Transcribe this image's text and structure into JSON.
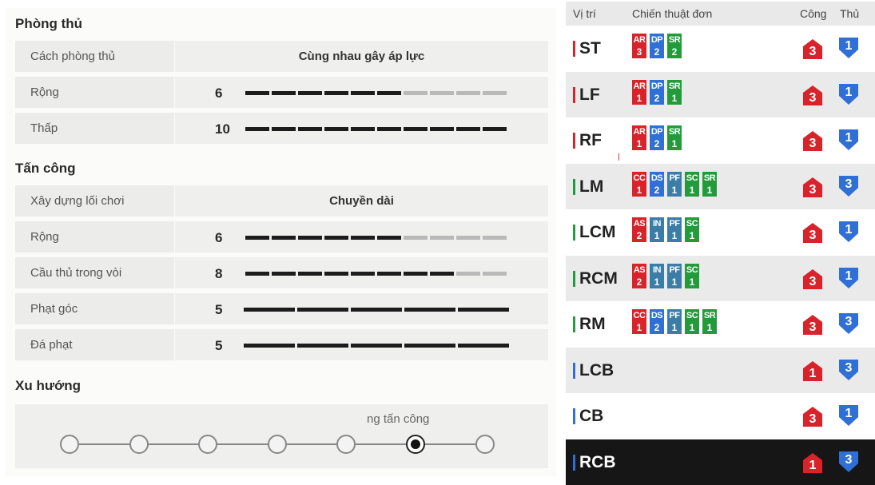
{
  "left": {
    "defense_title": "Phòng thủ",
    "defense": {
      "style": {
        "label": "Cách phòng thủ",
        "value": "Cùng nhau gây áp lực"
      },
      "width": {
        "label": "Rộng",
        "value": "6",
        "level": 6
      },
      "depth": {
        "label": "Thấp",
        "value": "10",
        "level": 10
      }
    },
    "attack_title": "Tấn công",
    "attack": {
      "buildup": {
        "label": "Xây dựng lối chơi",
        "value": "Chuyền dài"
      },
      "width": {
        "label": "Rộng",
        "value": "6",
        "level": 6
      },
      "players_in_box": {
        "label": "Cầu thủ trong vòi",
        "value": "8",
        "level": 8
      },
      "corners": {
        "label": "Phạt góc",
        "value": "5",
        "level": 5
      },
      "free_kicks": {
        "label": "Đá phạt",
        "value": "5",
        "level": 5
      }
    },
    "tendency_title": "Xu hướng",
    "tendency": {
      "label": "ng tấn công",
      "selected_index": 5,
      "nodes": 7
    }
  },
  "right": {
    "headers": {
      "position": "Vị trí",
      "tactics": "Chiến thuật đơn",
      "attack": "Công",
      "defense": "Thủ"
    },
    "colors": {
      "red": "#d8232a",
      "blue": "#2f6fd6",
      "teal": "#3c7da8",
      "green": "#239b3b",
      "attack_badge": "#d8232a",
      "defense_badge": "#2f6fd6"
    },
    "rows": [
      {
        "pos": "ST",
        "bar": "#d8232a",
        "bg": "w",
        "chips": [
          {
            "ab": "AR",
            "lv": "3",
            "c": "red"
          },
          {
            "ab": "DP",
            "lv": "2",
            "c": "blue"
          },
          {
            "ab": "SR",
            "lv": "2",
            "c": "green"
          }
        ],
        "atk": "3",
        "def": "1"
      },
      {
        "pos": "LF",
        "bar": "#d8232a",
        "bg": "g",
        "chips": [
          {
            "ab": "AR",
            "lv": "1",
            "c": "red"
          },
          {
            "ab": "DP",
            "lv": "2",
            "c": "blue"
          },
          {
            "ab": "SR",
            "lv": "1",
            "c": "green"
          }
        ],
        "atk": "3",
        "def": "1"
      },
      {
        "pos": "RF",
        "bar": "#d8232a",
        "bg": "w",
        "chips": [
          {
            "ab": "AR",
            "lv": "1",
            "c": "red"
          },
          {
            "ab": "DP",
            "lv": "2",
            "c": "blue"
          },
          {
            "ab": "SR",
            "lv": "1",
            "c": "green"
          }
        ],
        "atk": "3",
        "def": "1"
      },
      {
        "pos": "LM",
        "bar": "#239b3b",
        "bg": "g",
        "chips": [
          {
            "ab": "CC",
            "lv": "1",
            "c": "red"
          },
          {
            "ab": "DS",
            "lv": "2",
            "c": "blue"
          },
          {
            "ab": "PF",
            "lv": "1",
            "c": "teal"
          },
          {
            "ab": "SC",
            "lv": "1",
            "c": "green"
          },
          {
            "ab": "SR",
            "lv": "1",
            "c": "green"
          }
        ],
        "atk": "3",
        "def": "3"
      },
      {
        "pos": "LCM",
        "bar": "#239b3b",
        "bg": "w",
        "chips": [
          {
            "ab": "AS",
            "lv": "2",
            "c": "red"
          },
          {
            "ab": "IN",
            "lv": "1",
            "c": "teal"
          },
          {
            "ab": "PF",
            "lv": "1",
            "c": "teal"
          },
          {
            "ab": "SC",
            "lv": "1",
            "c": "green"
          }
        ],
        "atk": "3",
        "def": "1"
      },
      {
        "pos": "RCM",
        "bar": "#239b3b",
        "bg": "g",
        "chips": [
          {
            "ab": "AS",
            "lv": "2",
            "c": "red"
          },
          {
            "ab": "IN",
            "lv": "1",
            "c": "teal"
          },
          {
            "ab": "PF",
            "lv": "1",
            "c": "teal"
          },
          {
            "ab": "SC",
            "lv": "1",
            "c": "green"
          }
        ],
        "atk": "3",
        "def": "1"
      },
      {
        "pos": "RM",
        "bar": "#239b3b",
        "bg": "w",
        "chips": [
          {
            "ab": "CC",
            "lv": "1",
            "c": "red"
          },
          {
            "ab": "DS",
            "lv": "2",
            "c": "blue"
          },
          {
            "ab": "PF",
            "lv": "1",
            "c": "teal"
          },
          {
            "ab": "SC",
            "lv": "1",
            "c": "green"
          },
          {
            "ab": "SR",
            "lv": "1",
            "c": "green"
          }
        ],
        "atk": "3",
        "def": "3"
      },
      {
        "pos": "LCB",
        "bar": "#2f6fd6",
        "bg": "g",
        "chips": [],
        "atk": "1",
        "def": "3"
      },
      {
        "pos": "CB",
        "bar": "#2f6fd6",
        "bg": "w",
        "chips": [],
        "atk": "3",
        "def": "1"
      },
      {
        "pos": "RCB",
        "bar": "#2f6fd6",
        "bg": "d",
        "chips": [],
        "atk": "1",
        "def": "3"
      }
    ]
  }
}
